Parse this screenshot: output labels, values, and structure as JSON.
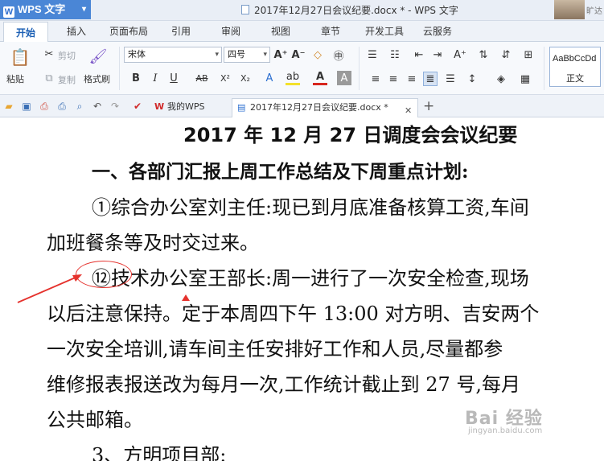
{
  "app": {
    "name": "WPS 文字",
    "window_title": "2017年12月27日会议纪要.docx * - WPS 文字",
    "user_name": "旷达"
  },
  "ribbon_tabs": [
    "开始",
    "插入",
    "页面布局",
    "引用",
    "审阅",
    "视图",
    "章节",
    "开发工具",
    "云服务"
  ],
  "active_ribbon_tab": "开始",
  "toolbar": {
    "paste": "粘贴",
    "cut": "剪切",
    "copy": "复制",
    "format_painter": "格式刷",
    "font_name": "宋体",
    "font_size": "四号",
    "style_preview": "AaBbCcDd",
    "style_name": "正文"
  },
  "doc_tabs": [
    {
      "label": "我的WPS",
      "active": false
    },
    {
      "label": "2017年12月27日会议纪要.docx *",
      "active": true
    }
  ],
  "document": {
    "title": "2017 年 12 月 27 日调度会会议纪要",
    "section1_heading": "一、各部门汇报上周工作总结及下周重点计划:",
    "para1_line1": "①综合办公室刘主任:现已到月底准备核算工资,车间",
    "para1_line2": "加班餐条等及时交过来。",
    "para2_line1": "⑫技术办公室王部长:周一进行了一次安全检查,现场",
    "para2_line2": "以后注意保持。定于本周四下午 13:00 对方明、吉安两个",
    "para2_line3": "一次安全培训,请车间主任安排好工作和人员,尽量都参",
    "para2_line4": "维修报表报送改为每月一次,工作统计截止到 27 号,每月",
    "para2_line5": "公共邮箱。",
    "section3_heading": "3、方明项目部:"
  },
  "watermark": {
    "main": "Bai 经验",
    "sub": "jingyan.baidu.com"
  },
  "colors": {
    "accent": "#4a86d6",
    "annotation": "#e5322d"
  }
}
